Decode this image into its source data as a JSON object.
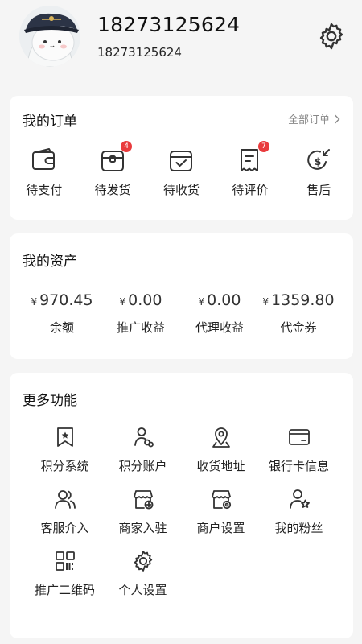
{
  "profile": {
    "phone_main": "18273125624",
    "phone_sub": "18273125624",
    "settings_icon": "gear-icon"
  },
  "orders": {
    "title": "我的订单",
    "all_orders_label": "全部订单",
    "items": [
      {
        "label": "待支付",
        "icon": "wallet-icon",
        "badge": ""
      },
      {
        "label": "待发货",
        "icon": "package-icon",
        "badge": "4"
      },
      {
        "label": "待收货",
        "icon": "box-check-icon",
        "badge": ""
      },
      {
        "label": "待评价",
        "icon": "receipt-icon",
        "badge": "7"
      },
      {
        "label": "售后",
        "icon": "refund-icon",
        "badge": ""
      }
    ]
  },
  "assets": {
    "title": "我的资产",
    "currency": "¥",
    "items": [
      {
        "value": "970.45",
        "label": "余额"
      },
      {
        "value": "0.00",
        "label": "推广收益"
      },
      {
        "value": "0.00",
        "label": "代理收益"
      },
      {
        "value": "1359.80",
        "label": "代金券"
      }
    ]
  },
  "more": {
    "title": "更多功能",
    "items": [
      {
        "label": "积分系统",
        "icon": "bookmark-star-icon"
      },
      {
        "label": "积分账户",
        "icon": "user-link-icon"
      },
      {
        "label": "收货地址",
        "icon": "location-pin-icon"
      },
      {
        "label": "银行卡信息",
        "icon": "bank-card-icon"
      },
      {
        "label": "客服介入",
        "icon": "users-icon"
      },
      {
        "label": "商家入驻",
        "icon": "store-add-icon"
      },
      {
        "label": "商户设置",
        "icon": "store-settings-icon"
      },
      {
        "label": "我的粉丝",
        "icon": "user-star-icon"
      },
      {
        "label": "推广二维码",
        "icon": "qr-code-icon"
      },
      {
        "label": "个人设置",
        "icon": "gear-icon"
      }
    ]
  },
  "colors": {
    "badge": "#e93b3d",
    "background": "#f5f5f5",
    "card": "#ffffff"
  }
}
